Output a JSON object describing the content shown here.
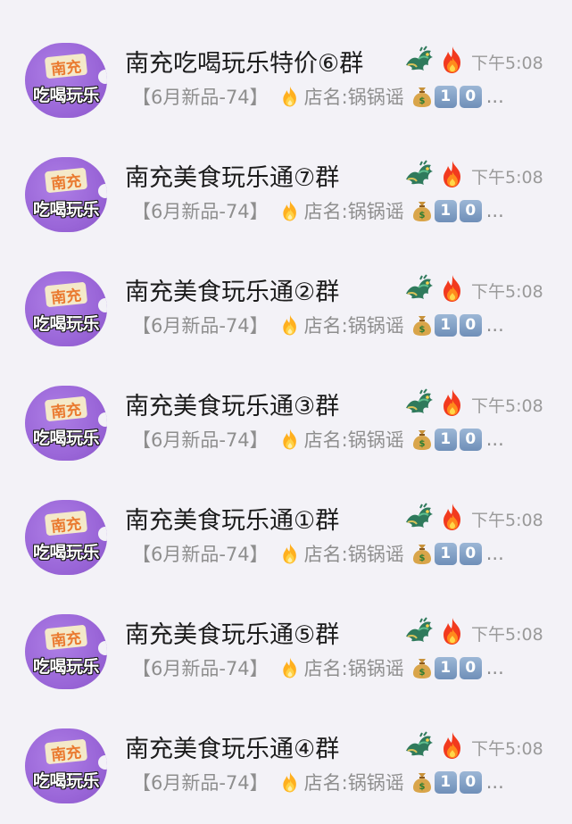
{
  "avatar": {
    "line1": "南充",
    "line2": "吃喝玩乐"
  },
  "chats": [
    {
      "title": "南充吃喝玩乐特价⑥群",
      "time": "下午5:08",
      "tag": "【6月新品-74】",
      "shop": "店名:锅锅谣",
      "keys": [
        "1",
        "0"
      ],
      "ellipsis": "..."
    },
    {
      "title": "南充美食玩乐通⑦群",
      "time": "下午5:08",
      "tag": "【6月新品-74】",
      "shop": "店名:锅锅谣",
      "keys": [
        "1",
        "0"
      ],
      "ellipsis": "..."
    },
    {
      "title": "南充美食玩乐通②群",
      "time": "下午5:08",
      "tag": "【6月新品-74】",
      "shop": "店名:锅锅谣",
      "keys": [
        "1",
        "0"
      ],
      "ellipsis": "..."
    },
    {
      "title": "南充美食玩乐通③群",
      "time": "下午5:08",
      "tag": "【6月新品-74】",
      "shop": "店名:锅锅谣",
      "keys": [
        "1",
        "0"
      ],
      "ellipsis": "..."
    },
    {
      "title": "南充美食玩乐通①群",
      "time": "下午5:08",
      "tag": "【6月新品-74】",
      "shop": "店名:锅锅谣",
      "keys": [
        "1",
        "0"
      ],
      "ellipsis": "..."
    },
    {
      "title": "南充美食玩乐通⑤群",
      "time": "下午5:08",
      "tag": "【6月新品-74】",
      "shop": "店名:锅锅谣",
      "keys": [
        "1",
        "0"
      ],
      "ellipsis": "..."
    },
    {
      "title": "南充美食玩乐通④群",
      "time": "下午5:08",
      "tag": "【6月新品-74】",
      "shop": "店名:锅锅谣",
      "keys": [
        "1",
        "0"
      ],
      "ellipsis": "..."
    }
  ],
  "icons": {
    "title_emojis": [
      "dragon-icon",
      "fire-icon"
    ],
    "preview_emojis": [
      "fire-icon",
      "money-bag-icon",
      "keycap-1-icon",
      "keycap-0-icon"
    ]
  },
  "colors": {
    "background": "#f3f2f7",
    "avatar_purple": "#9a66d8",
    "avatar_orange_text": "#ea7a30",
    "title_text": "#1c1c1c",
    "secondary_text": "#8e8e8e",
    "keycap_blue": "#7f9ec6"
  }
}
